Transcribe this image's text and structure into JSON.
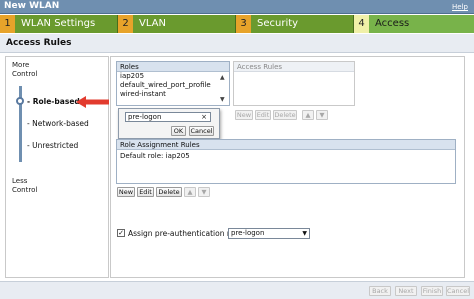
{
  "window": {
    "title": "New WLAN",
    "help_label": "Help"
  },
  "wizard": {
    "tabs": [
      {
        "num": "1",
        "label": "WLAN Settings"
      },
      {
        "num": "2",
        "label": "VLAN"
      },
      {
        "num": "3",
        "label": "Security"
      },
      {
        "num": "4",
        "label": "Access"
      }
    ],
    "active_tab": "Access"
  },
  "section": {
    "title": "Access Rules"
  },
  "slider": {
    "more_label": "More Control",
    "less_label": "Less Control",
    "options": [
      "- Role-based",
      "- Network-based",
      "- Unrestricted"
    ],
    "selected": "- Role-based"
  },
  "roles": {
    "header": "Roles",
    "items": [
      "iap205",
      "default_wired_port_profile",
      "wired-instant"
    ]
  },
  "access_rules": {
    "header": "Access Rules",
    "buttons": [
      "New",
      "Edit",
      "Delete",
      "▲",
      "▼"
    ]
  },
  "popup": {
    "input_value": "pre-logon",
    "clear_glyph": "×",
    "ok_label": "OK",
    "cancel_label": "Cancel"
  },
  "role_assignment": {
    "header": "Role Assignment Rules",
    "rows": [
      "Default role: iap205"
    ],
    "buttons": [
      "New",
      "Edit",
      "Delete",
      "▲",
      "▼"
    ]
  },
  "pre_auth": {
    "checked": true,
    "check_glyph": "✓",
    "label": "Assign pre-authentication role:",
    "selected_value": "pre-logon",
    "caret": "▼"
  },
  "footer": {
    "back_label": "Back",
    "next_label": "Next",
    "finish_label": "Finish",
    "cancel_label": "Cancel"
  },
  "colors": {
    "title_bar": "#6f8fb0",
    "tab_bar": "#6a9a2e",
    "tab_number": "#e7a32a",
    "arrow": "#e23b2e"
  }
}
